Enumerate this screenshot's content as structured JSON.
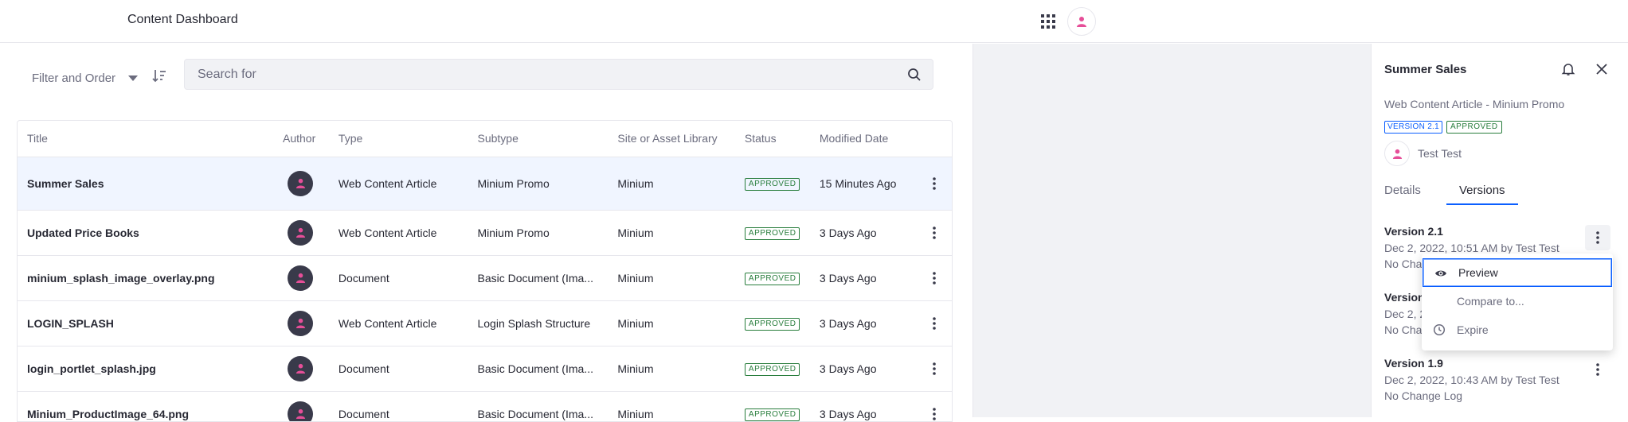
{
  "header": {
    "title": "Content Dashboard",
    "apps_icon": "apps-grid-icon",
    "user_icon": "user-avatar-icon"
  },
  "toolbar": {
    "filter_label": "Filter and Order",
    "order_icon": "sort-order-icon",
    "search_placeholder": "Search for",
    "search_icon": "search-icon"
  },
  "table": {
    "columns": [
      "Title",
      "Author",
      "Type",
      "Subtype",
      "Site or Asset Library",
      "Status",
      "Modified Date"
    ],
    "rows": [
      {
        "title": "Summer Sales",
        "type": "Web Content Article",
        "subtype": "Minium Promo",
        "site": "Minium",
        "status": "APPROVED",
        "modified": "15 Minutes Ago"
      },
      {
        "title": "Updated Price Books",
        "type": "Web Content Article",
        "subtype": "Minium Promo",
        "site": "Minium",
        "status": "APPROVED",
        "modified": "3 Days Ago"
      },
      {
        "title": "minium_splash_image_overlay.png",
        "type": "Document",
        "subtype": "Basic Document (Ima...",
        "site": "Minium",
        "status": "APPROVED",
        "modified": "3 Days Ago"
      },
      {
        "title": "LOGIN_SPLASH",
        "type": "Web Content Article",
        "subtype": "Login Splash Structure",
        "site": "Minium",
        "status": "APPROVED",
        "modified": "3 Days Ago"
      },
      {
        "title": "login_portlet_splash.jpg",
        "type": "Document",
        "subtype": "Basic Document (Ima...",
        "site": "Minium",
        "status": "APPROVED",
        "modified": "3 Days Ago"
      },
      {
        "title": "Minium_ProductImage_64.png",
        "type": "Document",
        "subtype": "Basic Document (Ima...",
        "site": "Minium",
        "status": "APPROVED",
        "modified": "3 Days Ago"
      }
    ]
  },
  "panel": {
    "title": "Summer Sales",
    "subtitle": "Web Content Article - Minium Promo",
    "version_badge": "VERSION 2.1",
    "status_badge": "APPROVED",
    "user_name": "Test Test",
    "tabs": [
      "Details",
      "Versions"
    ],
    "active_tab": "Versions",
    "versions": [
      {
        "name": "Version 2.1",
        "date": "Dec 2, 2022, 10:51 AM by Test Test",
        "log": "No Change Log"
      },
      {
        "name": "Version 2.0",
        "date": "Dec 2, 2022, 10:47 AM by Test Test",
        "log": "No Change Log"
      },
      {
        "name": "Version 1.9",
        "date": "Dec 2, 2022, 10:43 AM by Test Test",
        "log": "No Change Log"
      }
    ]
  },
  "dropdown": {
    "items": [
      {
        "label": "Preview",
        "icon": "eye-icon"
      },
      {
        "label": "Compare to...",
        "icon": ""
      },
      {
        "label": "Expire",
        "icon": "clock-icon"
      }
    ]
  },
  "colors": {
    "accent": "#0b5fff",
    "approved": "#287d3c",
    "avatar_pink": "#e64e98",
    "selected_row": "#f0f5ff"
  }
}
